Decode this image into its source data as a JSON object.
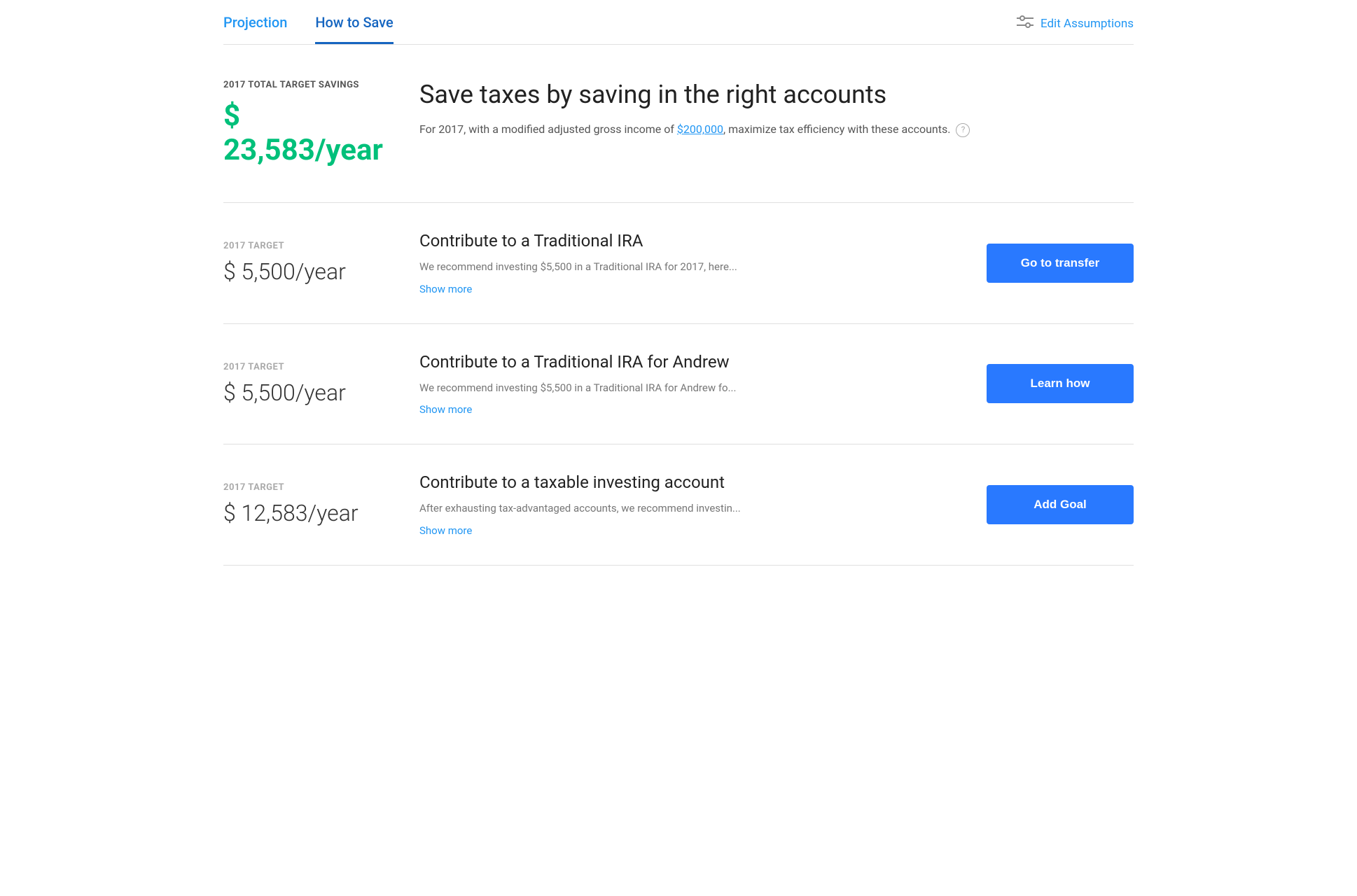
{
  "tabs": [
    {
      "id": "projection",
      "label": "Projection",
      "active": false
    },
    {
      "id": "how-to-save",
      "label": "How to Save",
      "active": true
    }
  ],
  "edit_assumptions": {
    "label": "Edit Assumptions"
  },
  "hero": {
    "label": "2017 TOTAL TARGET SAVINGS",
    "amount": "$ 23,583/year",
    "title": "Save taxes by saving in the right accounts",
    "description_prefix": "For 2017, with a modified adjusted gross income of ",
    "income_link": "$200,000",
    "description_suffix": ", maximize tax efficiency with these accounts.",
    "info_icon": "?"
  },
  "recommendations": [
    {
      "label": "2017 TARGET",
      "amount": "$ 5,500/year",
      "title": "Contribute to a Traditional IRA",
      "description": "We recommend investing $5,500 in a Traditional IRA for 2017, here...",
      "show_more": "Show more",
      "button_label": "Go to transfer"
    },
    {
      "label": "2017 TARGET",
      "amount": "$ 5,500/year",
      "title": "Contribute to a Traditional IRA for Andrew",
      "description": "We recommend investing $5,500 in a Traditional IRA for Andrew fo...",
      "show_more": "Show more",
      "button_label": "Learn how"
    },
    {
      "label": "2017 TARGET",
      "amount": "$ 12,583/year",
      "title": "Contribute to a taxable investing account",
      "description": "After exhausting tax-advantaged accounts, we recommend investin...",
      "show_more": "Show more",
      "button_label": "Add Goal"
    }
  ]
}
